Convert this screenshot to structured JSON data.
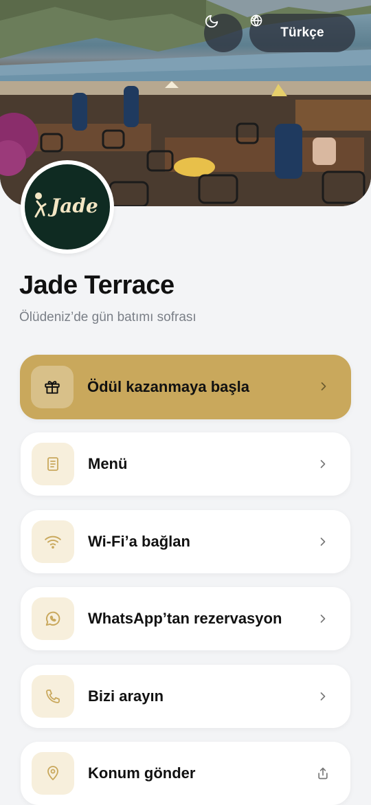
{
  "header": {
    "theme_toggle_icon": "moon-icon",
    "language": {
      "icon": "globe-icon",
      "label": "Türkçe",
      "dropdown_icon": "chevron-down-icon"
    }
  },
  "restaurant": {
    "logo_text": "Jade",
    "name": "Jade Terrace",
    "tagline": "Ölüdeniz’de gün batımı sofrası"
  },
  "colors": {
    "accent": "#c9a85c",
    "icon_bg": "#f7efdc",
    "logo_bg": "#0f2b22"
  },
  "actions": [
    {
      "label": "Ödül kazanmaya başla",
      "icon": "gift-icon",
      "trailing": "chevron-right-icon"
    },
    {
      "label": "Menü",
      "icon": "document-icon",
      "trailing": "chevron-right-icon"
    },
    {
      "label": "Wi-Fi’a bağlan",
      "icon": "wifi-icon",
      "trailing": "chevron-right-icon"
    },
    {
      "label": "WhatsApp’tan rezervasyon",
      "icon": "whatsapp-icon",
      "trailing": "chevron-right-icon"
    },
    {
      "label": "Bizi arayın",
      "icon": "phone-icon",
      "trailing": "chevron-right-icon"
    },
    {
      "label": "Konum gönder",
      "icon": "location-pin-icon",
      "trailing": "share-icon"
    }
  ]
}
